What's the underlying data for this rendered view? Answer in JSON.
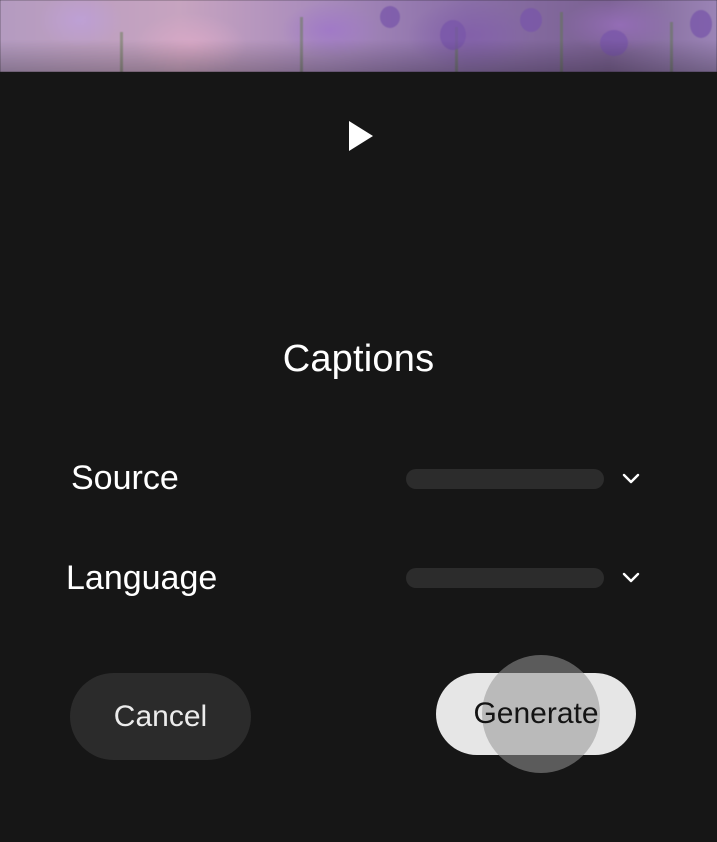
{
  "dialog": {
    "title": "Captions",
    "play_icon": "play-icon",
    "rows": [
      {
        "label": "Source",
        "value": "",
        "icon": "chevron-down-icon"
      },
      {
        "label": "Language",
        "value": "",
        "icon": "chevron-down-icon"
      }
    ],
    "buttons": {
      "cancel": "Cancel",
      "generate": "Generate"
    }
  },
  "colors": {
    "background": "#161616",
    "primary_button": "#e6e6e6",
    "secondary_button": "#2b2b2b",
    "dropdown_track": "#2c2c2c"
  }
}
